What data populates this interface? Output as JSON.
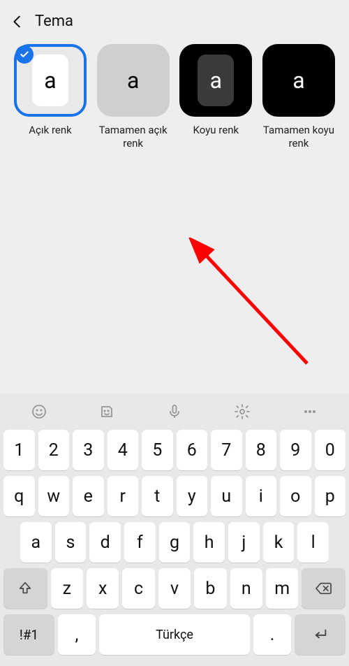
{
  "header": {
    "title": "Tema"
  },
  "themes": [
    {
      "label": "Açık renk",
      "letter": "a",
      "selected": true
    },
    {
      "label": "Tamamen açık renk",
      "letter": "a",
      "selected": false
    },
    {
      "label": "Koyu renk",
      "letter": "a",
      "selected": false
    },
    {
      "label": "Tamamen koyu renk",
      "letter": "a",
      "selected": false
    }
  ],
  "keyboard": {
    "row_num": [
      "1",
      "2",
      "3",
      "4",
      "5",
      "6",
      "7",
      "8",
      "9",
      "0"
    ],
    "row1": [
      "q",
      "w",
      "e",
      "r",
      "t",
      "y",
      "u",
      "i",
      "o",
      "p"
    ],
    "row2": [
      "a",
      "s",
      "d",
      "f",
      "g",
      "h",
      "j",
      "k",
      "l"
    ],
    "row3": [
      "z",
      "x",
      "c",
      "v",
      "b",
      "n",
      "m"
    ],
    "symbols_label": "!#1",
    "comma": ",",
    "dot": ".",
    "space_label": "Türkçe"
  }
}
